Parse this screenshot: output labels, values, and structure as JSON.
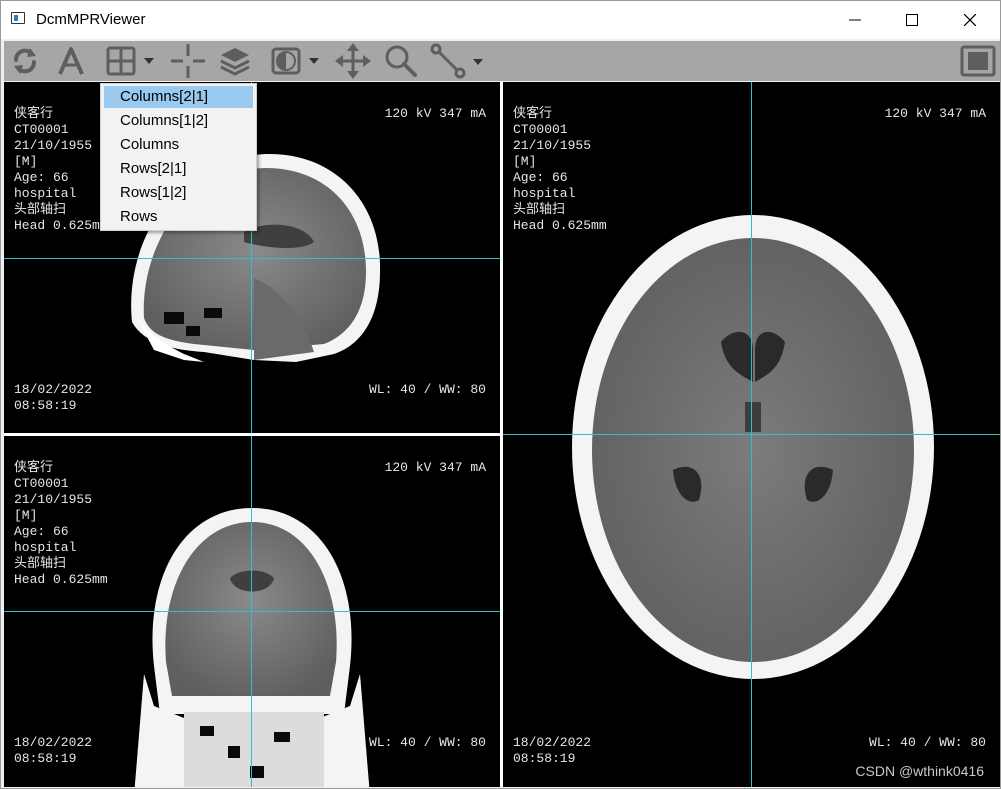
{
  "window": {
    "title": "DcmMPRViewer",
    "controls": [
      "minimize",
      "maximize",
      "close"
    ]
  },
  "toolbar": {
    "tools": [
      {
        "icon": "refresh-icon"
      },
      {
        "icon": "annotation-text-icon"
      },
      {
        "icon": "layout-grid-icon",
        "has_dropdown": true
      },
      {
        "icon": "crosshair-icon"
      },
      {
        "icon": "layers-icon"
      },
      {
        "icon": "window-level-icon",
        "has_dropdown": true
      },
      {
        "icon": "pan-move-icon"
      },
      {
        "icon": "zoom-magnifier-icon"
      },
      {
        "icon": "measure-line-icon",
        "has_dropdown": true
      },
      {
        "icon": "fullscreen-icon"
      }
    ]
  },
  "layout_menu": {
    "items": [
      "Columns[2|1]",
      "Columns[1|2]",
      "Columns",
      "Rows[2|1]",
      "Rows[1|2]",
      "Rows"
    ],
    "selected_index": 0
  },
  "views": {
    "sagittal": {
      "patient_name": "侠客行",
      "patient_id": "CT00001",
      "birth_date": "21/10/1955",
      "sex": "[M]",
      "age": "Age: 66",
      "institution": "hospital",
      "series": "头部轴扫",
      "slice": "Head 0.625mm",
      "kv_ma": "120 kV 347 mA",
      "study_date": "18/02/2022",
      "study_time": "08:58:19",
      "wl_ww": "WL: 40 / WW: 80"
    },
    "coronal": {
      "patient_name": "侠客行",
      "patient_id": "CT00001",
      "birth_date": "21/10/1955",
      "sex": "[M]",
      "age": "Age: 66",
      "institution": "hospital",
      "series": "头部轴扫",
      "slice": "Head 0.625mm",
      "kv_ma": "120 kV 347 mA",
      "study_date": "18/02/2022",
      "study_time": "08:58:19",
      "wl_ww": "WL: 40 / WW: 80"
    },
    "axial": {
      "patient_name": "侠客行",
      "patient_id": "CT00001",
      "birth_date": "21/10/1955",
      "sex": "[M]",
      "age": "Age: 66",
      "institution": "hospital",
      "series": "头部轴扫",
      "slice": "Head 0.625mm",
      "kv_ma": "120 kV 347 mA",
      "study_date": "18/02/2022",
      "study_time": "08:58:19",
      "wl_ww": "WL: 40 / WW: 80"
    }
  },
  "colors": {
    "crosshair": "#2fc1c9",
    "toolbar_bg": "#a6a6a6",
    "menu_highlight": "#99c9ef"
  },
  "watermark": "CSDN @wthink0416"
}
